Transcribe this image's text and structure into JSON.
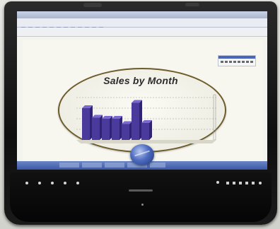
{
  "chart_data": {
    "type": "bar",
    "title": "Sales by Month",
    "categories": [
      "",
      "",
      "",
      "",
      "",
      "",
      ""
    ],
    "values": [
      6.0,
      4.2,
      4.0,
      4.0,
      3.0,
      7.0,
      3.2
    ],
    "ylim": [
      0,
      8
    ],
    "grid": true,
    "colors": {
      "bar_front": "#4a3a9c",
      "bar_top": "#7a6ad0",
      "bar_side": "#2e2470",
      "gridline": "#9a9a9a"
    }
  },
  "icons": {
    "globe": "globe-icon"
  }
}
